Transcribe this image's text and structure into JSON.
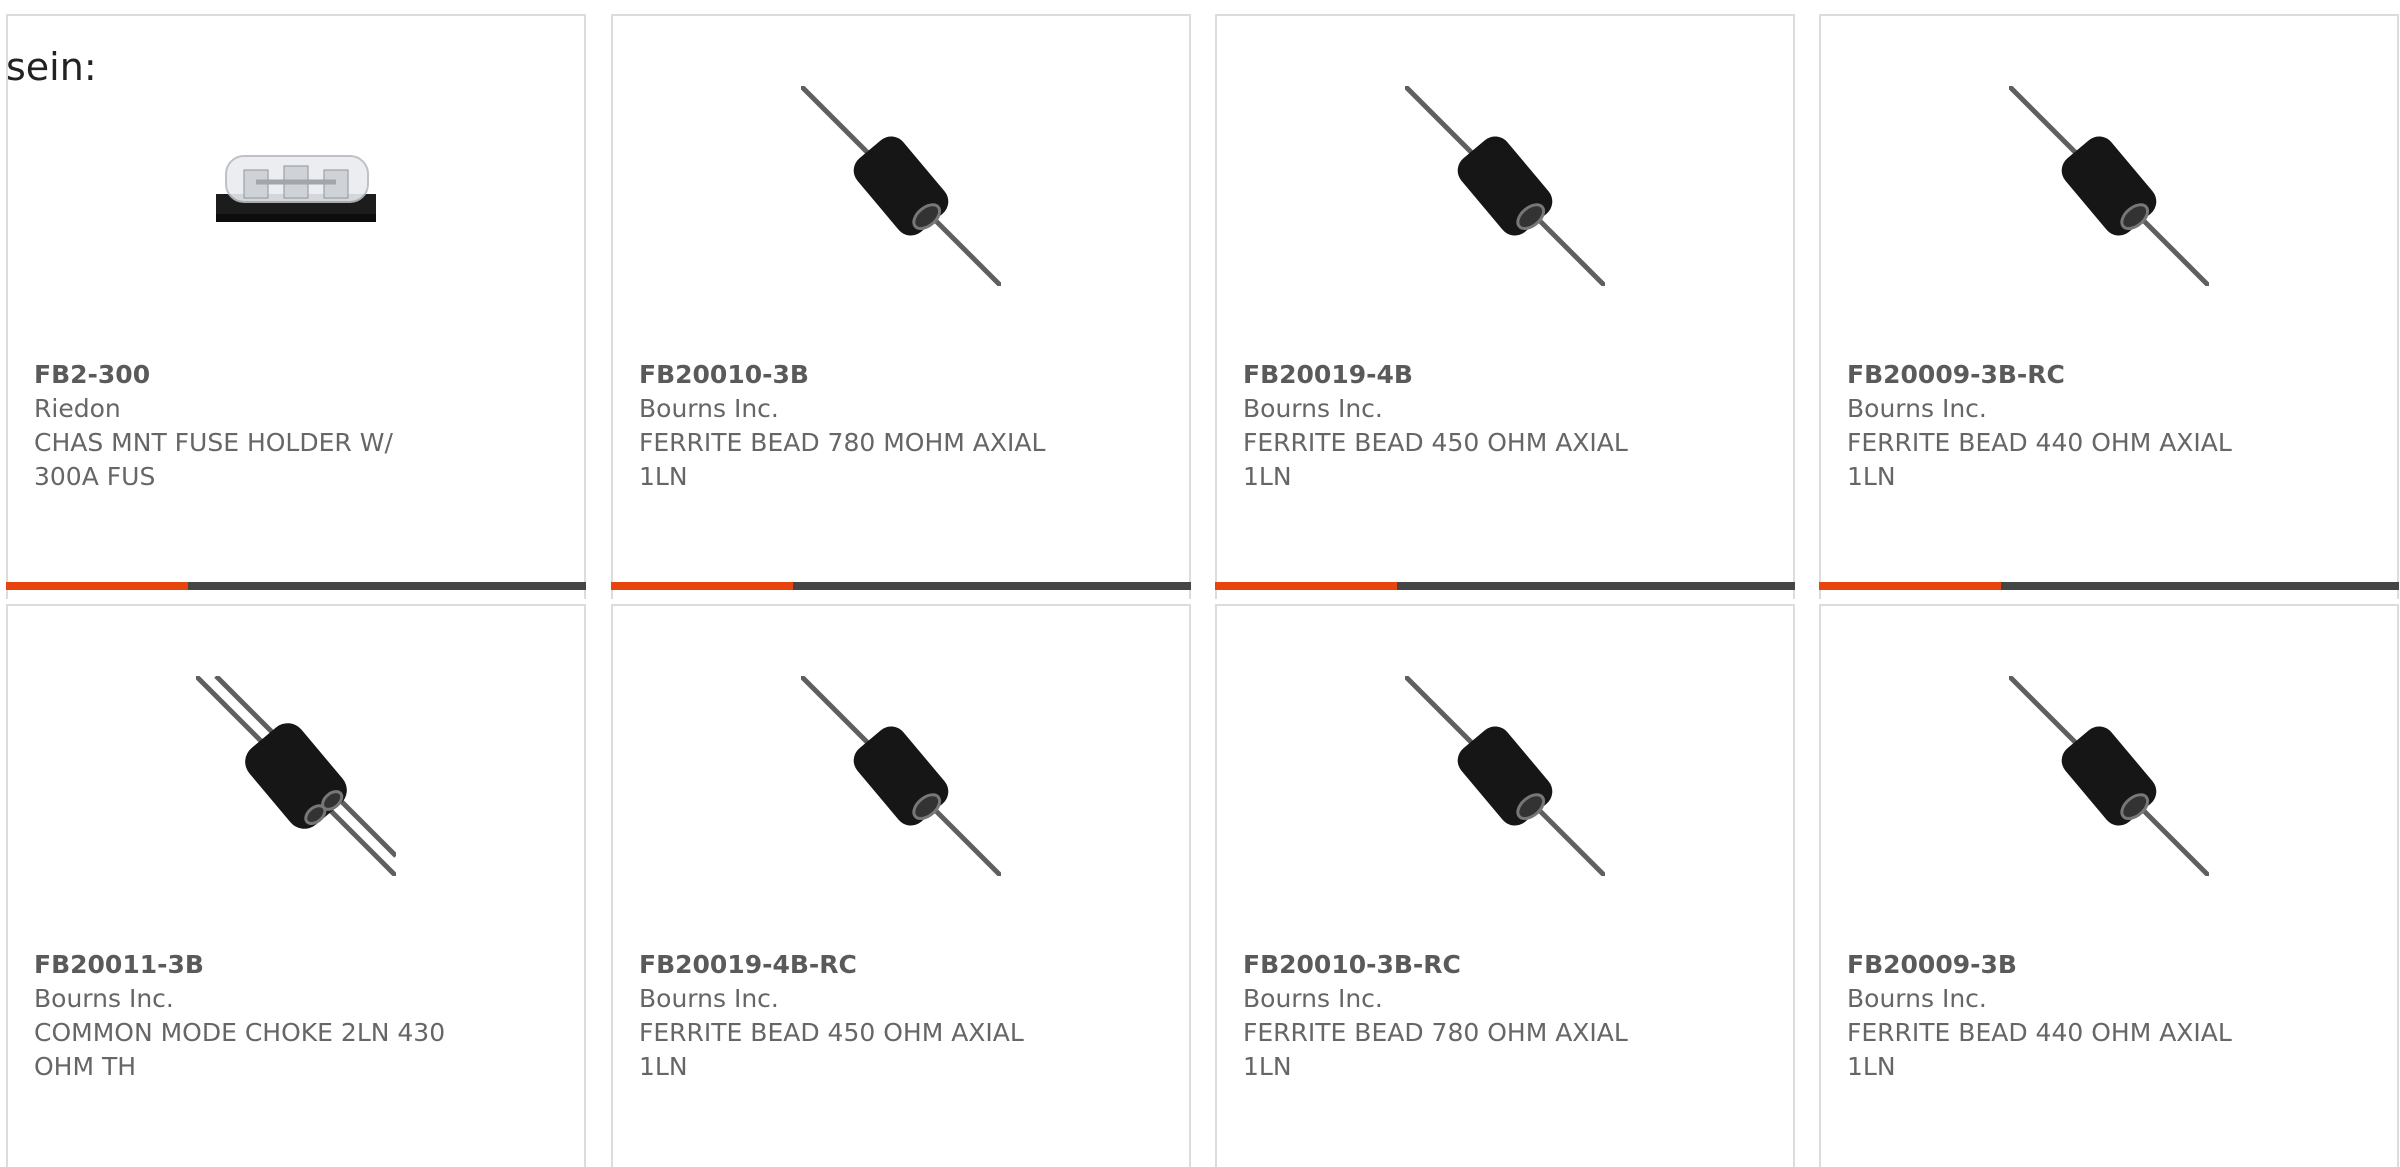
{
  "heading": "sein:",
  "colors": {
    "accent": "#e8440e",
    "bar": "#454545",
    "border": "#dcdcdc"
  },
  "products": [
    {
      "part": "FB2-300",
      "manufacturer": "Riedon",
      "description": "CHAS MNT FUSE HOLDER W/ 300A FUS",
      "image": "fuse-holder-image"
    },
    {
      "part": "FB20010-3B",
      "manufacturer": "Bourns Inc.",
      "description": "FERRITE BEAD 780 MOHM AXIAL 1LN",
      "image": "ferrite-bead-image"
    },
    {
      "part": "FB20019-4B",
      "manufacturer": "Bourns Inc.",
      "description": "FERRITE BEAD 450 OHM AXIAL 1LN",
      "image": "ferrite-bead-image"
    },
    {
      "part": "FB20009-3B-RC",
      "manufacturer": "Bourns Inc.",
      "description": "FERRITE BEAD 440 OHM AXIAL 1LN",
      "image": "ferrite-bead-image"
    },
    {
      "part": "FB20011-3B",
      "manufacturer": "Bourns Inc.",
      "description": "COMMON MODE CHOKE 2LN 430 OHM TH",
      "image": "common-mode-choke-image"
    },
    {
      "part": "FB20019-4B-RC",
      "manufacturer": "Bourns Inc.",
      "description": "FERRITE BEAD 450 OHM AXIAL 1LN",
      "image": "ferrite-bead-image"
    },
    {
      "part": "FB20010-3B-RC",
      "manufacturer": "Bourns Inc.",
      "description": "FERRITE BEAD 780 OHM AXIAL 1LN",
      "image": "ferrite-bead-image"
    },
    {
      "part": "FB20009-3B",
      "manufacturer": "Bourns Inc.",
      "description": "FERRITE BEAD 440 OHM AXIAL 1LN",
      "image": "ferrite-bead-image"
    }
  ]
}
